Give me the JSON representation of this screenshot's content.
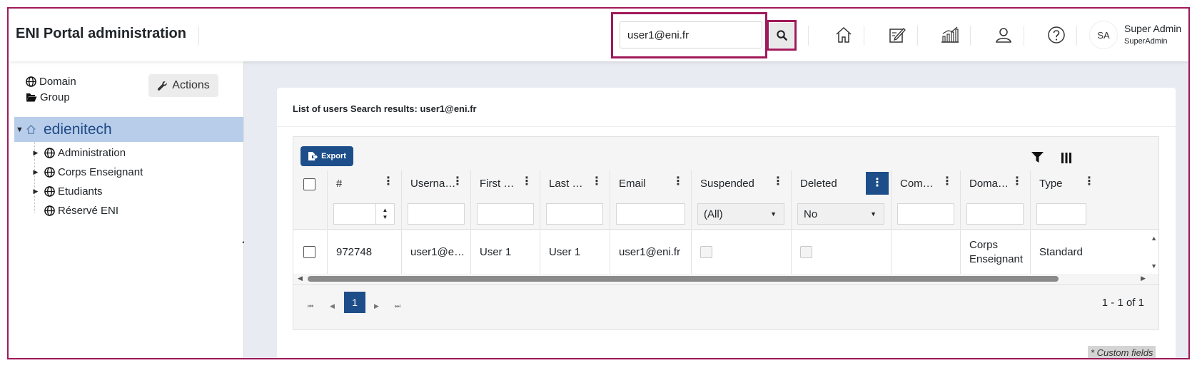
{
  "header": {
    "title": "ENI Portal administration",
    "search_value": "user1@eni.fr",
    "user_initials": "SA",
    "user_name": "Super Admin",
    "user_role": "SuperAdmin"
  },
  "sidebar": {
    "links": [
      "Domain",
      "Group"
    ],
    "actions_label": "Actions",
    "tree_root": "edienitech",
    "tree_items": [
      "Administration",
      "Corps Enseignant",
      "Etudiants",
      "Réservé ENI"
    ]
  },
  "main": {
    "list_title": "List of users Search results: user1@eni.fr",
    "export_label": "Export",
    "columns": [
      "#",
      "Userna…",
      "First …",
      "Last …",
      "Email",
      "Suspended",
      "Deleted",
      "Com…",
      "Doma…",
      "Type"
    ],
    "filters": {
      "suspended": "(All)",
      "deleted": "No"
    },
    "rows": [
      {
        "id": "972748",
        "username": "user1@e…",
        "first_name": "User 1",
        "last_name": "User 1",
        "email": "user1@eni.fr",
        "domain": "Corps Enseignant",
        "type": "Standard"
      }
    ],
    "pagination": {
      "current_page": "1",
      "info": "1 - 1 of 1"
    },
    "custom_fields_note": "* Custom fields"
  },
  "colors": {
    "highlight": "#a0195a",
    "primary": "#1d4e89",
    "selected_tree": "#b8cdea",
    "background": "#e8ebf2"
  }
}
